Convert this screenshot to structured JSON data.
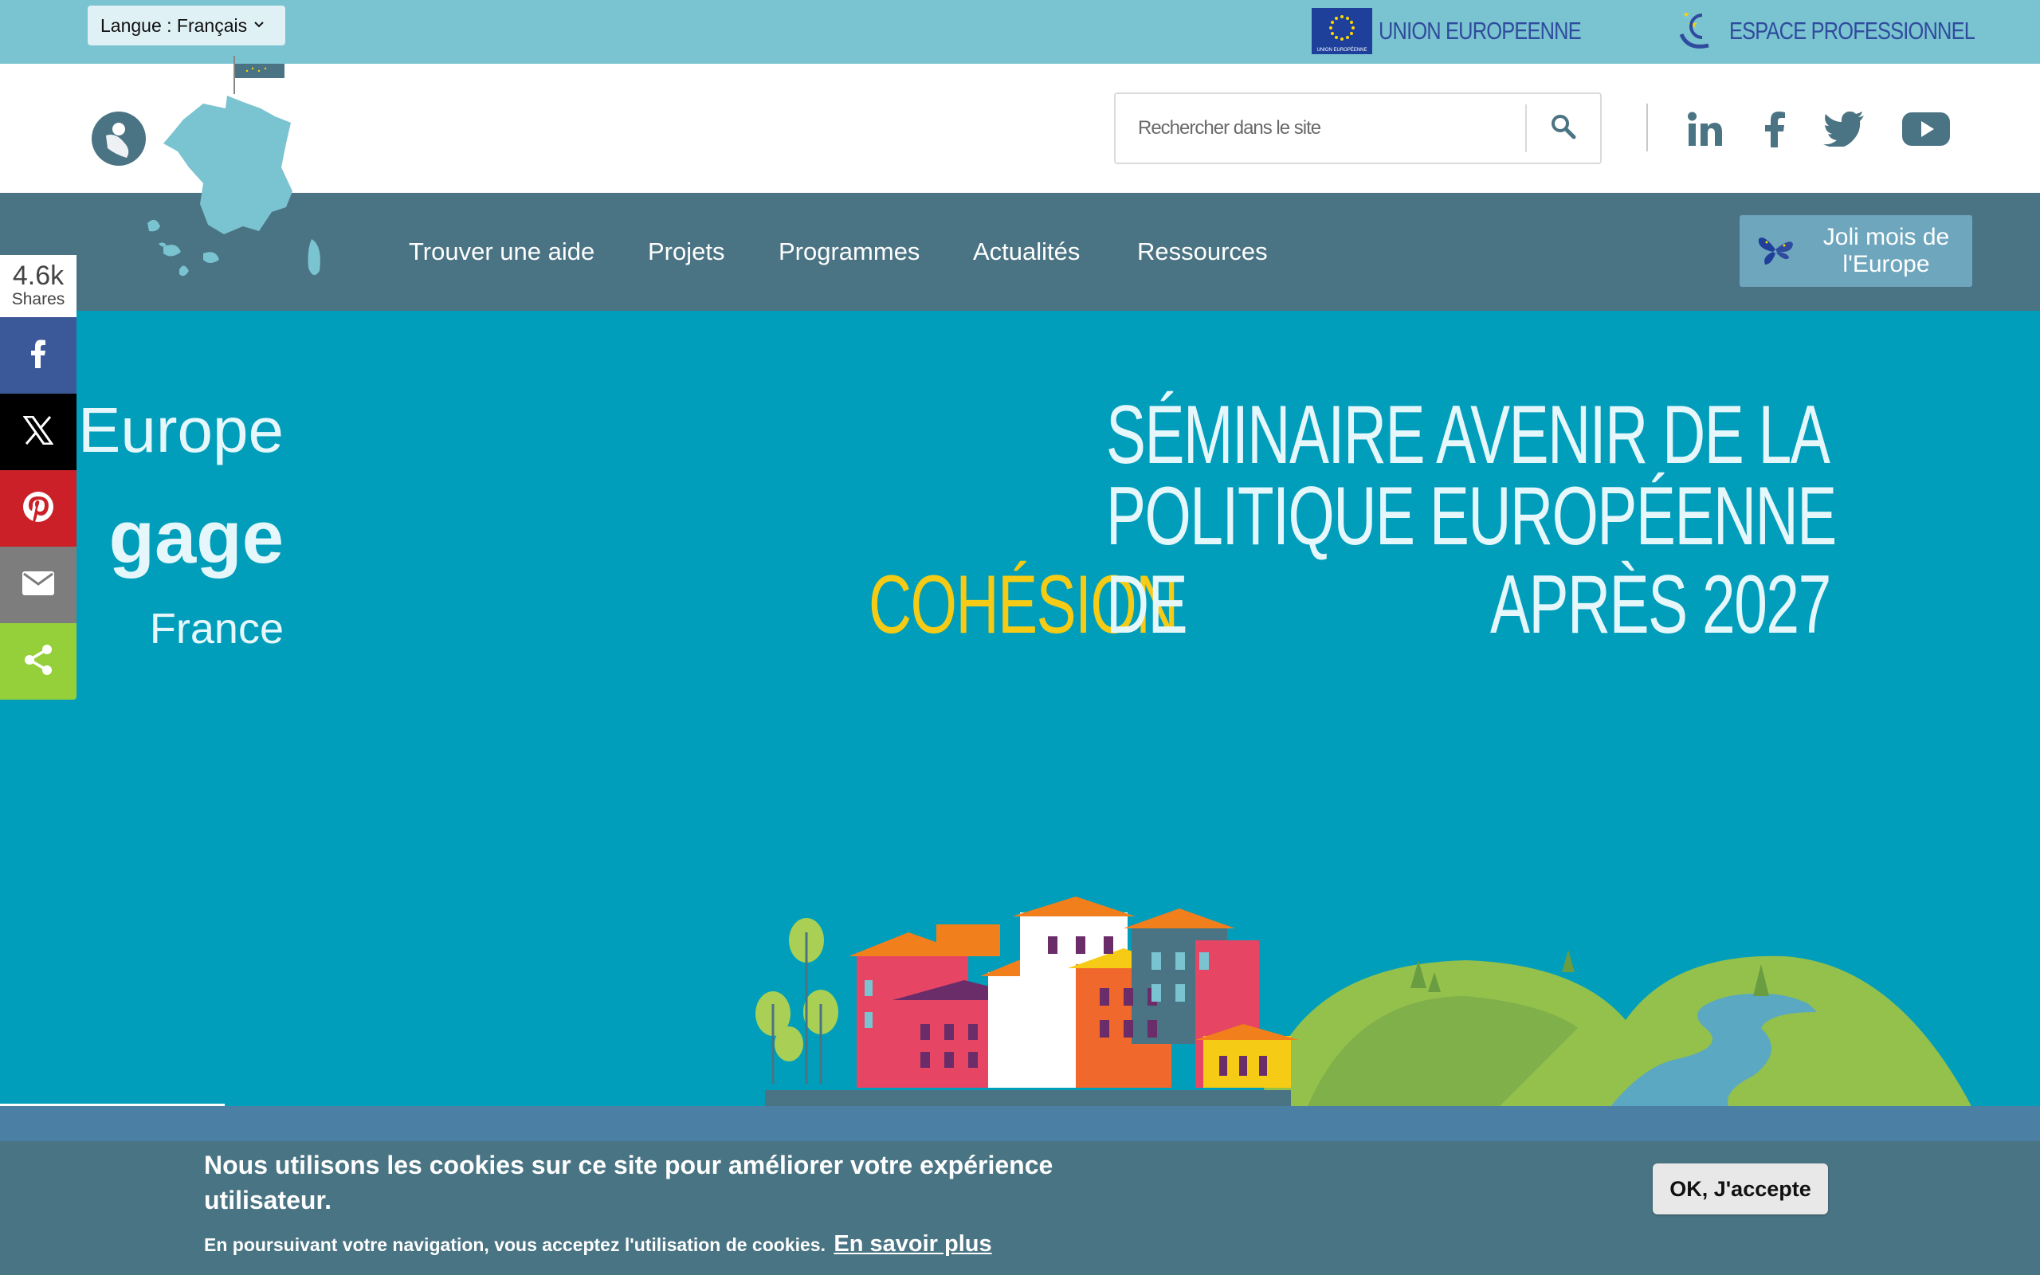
{
  "topbar": {
    "language_label": "Langue : Français",
    "eu_label": "UNION EUROPEENNE",
    "pro_label": "ESPACE PROFESSIONNEL",
    "eu_flag_caption": "UNION EUROPÉENNE"
  },
  "header": {
    "search_placeholder": "Rechercher dans le site",
    "social": [
      "linkedin-icon",
      "facebook-icon",
      "twitter-icon",
      "youtube-icon"
    ]
  },
  "nav": {
    "items": [
      "Trouver une aide",
      "Projets",
      "Programmes",
      "Actualités",
      "Ressources"
    ],
    "cta_label_line1": "Joli mois de",
    "cta_label_line2": "l'Europe"
  },
  "share": {
    "count": "4.6k",
    "label": "Shares",
    "buttons": [
      "facebook",
      "x",
      "pinterest",
      "email",
      "share"
    ],
    "colors": {
      "facebook": "#3b5998",
      "x": "#000000",
      "pinterest": "#cb2027",
      "email": "#7d7d7d",
      "share": "#95d03a"
    }
  },
  "hero": {
    "left_lines": [
      "l’Europe",
      "gage",
      "France"
    ],
    "title_line1": "SÉMINAIRE AVENIR DE LA",
    "title_line2": "POLITIQUE EUROPÉENNE",
    "title_line3_de": "DE",
    "title_highlight": "COHÉSION",
    "title_line3_end": "APRÈS 2027"
  },
  "cookie": {
    "title": "Nous utilisons les cookies sur ce site pour améliorer votre expérience utilisateur.",
    "text": "En poursuivant votre navigation, vous acceptez l'utilisation de cookies.",
    "more_link": "En savoir plus",
    "ok_button": "OK, J'accepte"
  },
  "colors": {
    "topbar": "#7ac3d0",
    "nav": "#4a7383",
    "hero": "#009ebb",
    "highlight": "#f5cb15",
    "cookie": "#497483"
  }
}
